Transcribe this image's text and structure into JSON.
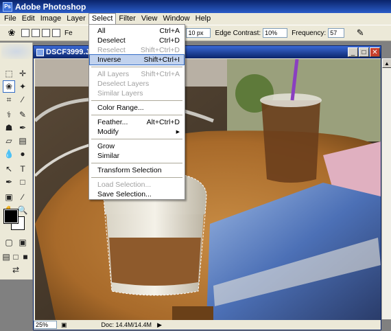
{
  "app": {
    "title": "Adobe Photoshop",
    "logo": "Ps"
  },
  "menubar": {
    "items": [
      "File",
      "Edit",
      "Image",
      "Layer",
      "Select",
      "Filter",
      "View",
      "Window",
      "Help"
    ],
    "active": "Select"
  },
  "options_bar": {
    "tool_icon": "magnetic-lasso-icon",
    "feather_label_partial": "Fe",
    "width_value": "10 px",
    "edge_contrast_label": "Edge Contrast:",
    "edge_contrast_value": "10%",
    "frequency_label": "Frequency:",
    "frequency_value": "57"
  },
  "document": {
    "title": "DSCF3999.J",
    "zoom": "25%",
    "doc_info": "Doc: 14.4M/14.4M"
  },
  "select_menu": {
    "items": [
      {
        "label": "All",
        "shortcut": "Ctrl+A",
        "enabled": true
      },
      {
        "label": "Deselect",
        "shortcut": "Ctrl+D",
        "enabled": true
      },
      {
        "label": "Reselect",
        "shortcut": "Shift+Ctrl+D",
        "enabled": false
      },
      {
        "label": "Inverse",
        "shortcut": "Shift+Ctrl+I",
        "enabled": true,
        "highlighted": true
      },
      {
        "label": "All Layers",
        "shortcut": "Shift+Ctrl+A",
        "enabled": false
      },
      {
        "label": "Deselect Layers",
        "shortcut": "",
        "enabled": false
      },
      {
        "label": "Similar Layers",
        "shortcut": "",
        "enabled": false
      },
      {
        "label": "Color Range...",
        "shortcut": "",
        "enabled": true
      },
      {
        "label": "Feather...",
        "shortcut": "Alt+Ctrl+D",
        "enabled": true
      },
      {
        "label": "Modify",
        "shortcut": "",
        "enabled": true,
        "submenu": true
      },
      {
        "label": "Grow",
        "shortcut": "",
        "enabled": true
      },
      {
        "label": "Similar",
        "shortcut": "",
        "enabled": true
      },
      {
        "label": "Transform Selection",
        "shortcut": "",
        "enabled": true
      },
      {
        "label": "Load Selection...",
        "shortcut": "",
        "enabled": false
      },
      {
        "label": "Save Selection...",
        "shortcut": "",
        "enabled": true
      }
    ]
  },
  "colors": {
    "titlebar": "#0a246a",
    "menu_bg": "#ece9d8",
    "highlight": "#c1d2ee"
  }
}
